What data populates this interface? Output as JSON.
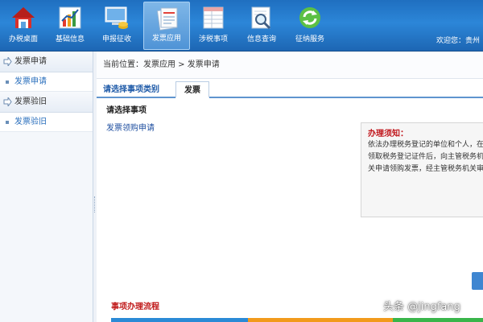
{
  "toolbar": {
    "items": [
      {
        "label": "办税桌面",
        "icon": "house-icon"
      },
      {
        "label": "基础信息",
        "icon": "bar-chart-icon"
      },
      {
        "label": "申报征收",
        "icon": "monitor-coins-icon"
      },
      {
        "label": "发票应用",
        "icon": "invoice-icon"
      },
      {
        "label": "涉税事项",
        "icon": "form-grid-icon"
      },
      {
        "label": "信息查询",
        "icon": "magnifier-icon"
      },
      {
        "label": "征纳服务",
        "icon": "refresh-arrows-icon"
      }
    ],
    "active_index": 3,
    "welcome": "欢迎您：贵州"
  },
  "sidebar": {
    "groups": [
      {
        "title": "发票申请",
        "items": [
          {
            "label": "发票申请"
          }
        ]
      },
      {
        "title": "发票验旧",
        "items": [
          {
            "label": "发票验旧"
          }
        ]
      }
    ]
  },
  "main": {
    "breadcrumb": "当前位置：发票应用 > 发票申请",
    "tabs": [
      {
        "label": "请选择事项类别"
      },
      {
        "label": "发票"
      }
    ],
    "section_title": "请选择事项",
    "link": "发票领购申请",
    "notice": {
      "title": "办理须知：",
      "text": "依法办理税务登记的单位和个人，在领取税务登记证件后，向主管税务机关申请领购发票，经主管税务机关审批后，发给发票领购簿。"
    },
    "flow_title": "事项办理流程"
  },
  "watermark": "头条 @jingfang",
  "colors": {
    "toolbar_blue": "#2c86d8",
    "link_blue": "#1f4fa0",
    "notice_red": "#c0141a",
    "flow_blue": "#2b8ad6",
    "flow_orange": "#f29a1c",
    "flow_green": "#39b54a"
  }
}
